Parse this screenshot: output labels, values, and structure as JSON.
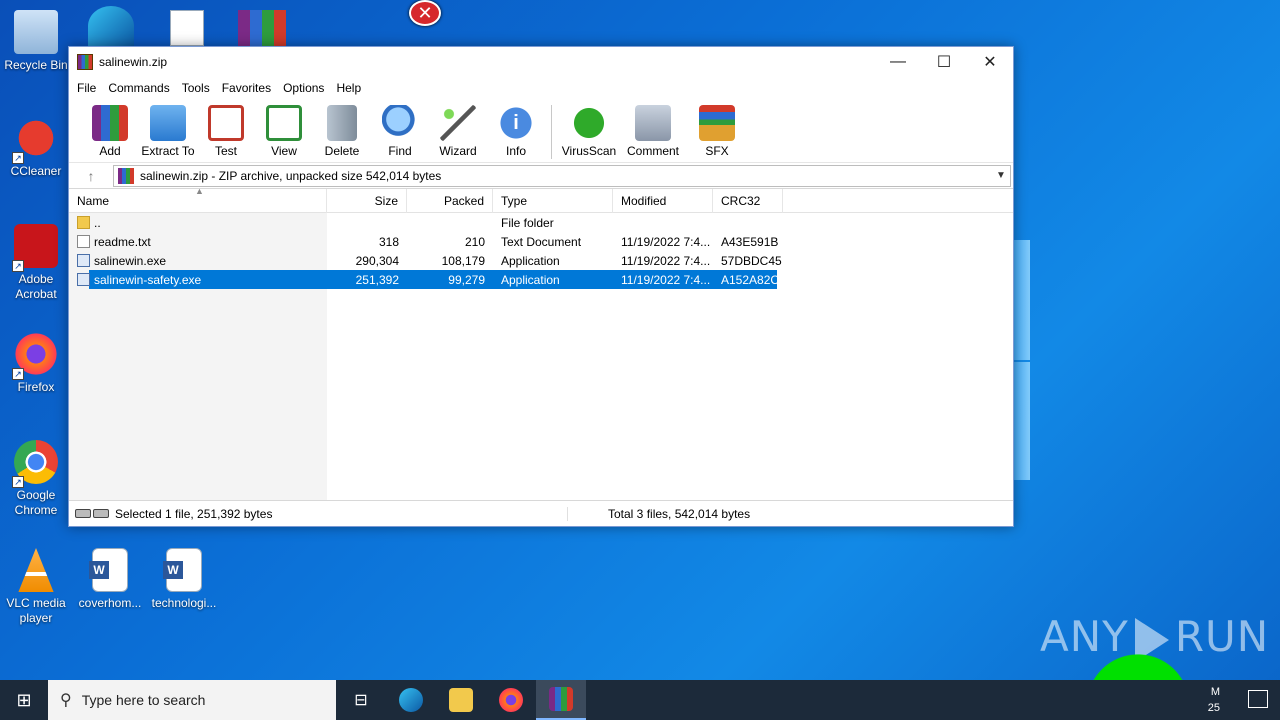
{
  "desktop": {
    "icons": [
      {
        "label": "Recycle Bin"
      },
      {
        "label": "CCleaner"
      },
      {
        "label": "Adobe Acrobat"
      },
      {
        "label": "Firefox"
      },
      {
        "label": "Google Chrome"
      },
      {
        "label": "VLC media player"
      },
      {
        "label": "coverhom..."
      },
      {
        "label": "technologi..."
      }
    ],
    "watermark": {
      "left": "ANY",
      "right": "RUN"
    }
  },
  "window": {
    "title": "salinewin.zip",
    "controls": {
      "minimize": "—",
      "maximize": "☐",
      "close": "✕"
    },
    "menu": [
      "File",
      "Commands",
      "Tools",
      "Favorites",
      "Options",
      "Help"
    ],
    "toolbar": [
      {
        "label": "Add",
        "icon": "add-icon",
        "color": "#b0322c"
      },
      {
        "label": "Extract To",
        "icon": "extract-folder-icon",
        "color": "#3a87d6"
      },
      {
        "label": "Test",
        "icon": "test-clipboard-icon",
        "color": "#c0392b"
      },
      {
        "label": "View",
        "icon": "view-book-icon",
        "color": "#2f8f3a"
      },
      {
        "label": "Delete",
        "icon": "delete-bin-icon",
        "color": "#8a9aaa"
      },
      {
        "label": "Find",
        "icon": "find-magnifier-icon",
        "color": "#2f6fc4"
      },
      {
        "label": "Wizard",
        "icon": "wizard-wand-icon",
        "color": "#6aa84f"
      },
      {
        "label": "Info",
        "icon": "info-icon",
        "color": "#2d66b8"
      },
      {
        "label": "VirusScan",
        "icon": "virusscan-bug-icon",
        "color": "#2faa2a"
      },
      {
        "label": "Comment",
        "icon": "comment-icon",
        "color": "#8a96a8"
      },
      {
        "label": "SFX",
        "icon": "sfx-box-icon",
        "color": "#e0a030"
      }
    ],
    "address": "salinewin.zip - ZIP archive, unpacked size 542,014 bytes",
    "columns": {
      "name": "Name",
      "size": "Size",
      "packed": "Packed",
      "type": "Type",
      "modified": "Modified",
      "crc": "CRC32"
    },
    "files": [
      {
        "name": "..",
        "size": "",
        "packed": "",
        "type": "File folder",
        "modified": "",
        "crc": "",
        "kind": "folder"
      },
      {
        "name": "readme.txt",
        "size": "318",
        "packed": "210",
        "type": "Text Document",
        "modified": "11/19/2022 7:4...",
        "crc": "A43E591B",
        "kind": "txt"
      },
      {
        "name": "salinewin.exe",
        "size": "290,304",
        "packed": "108,179",
        "type": "Application",
        "modified": "11/19/2022 7:4...",
        "crc": "57DBDC45",
        "kind": "exe"
      },
      {
        "name": "salinewin-safety.exe",
        "size": "251,392",
        "packed": "99,279",
        "type": "Application",
        "modified": "11/19/2022 7:4...",
        "crc": "A152A82C",
        "kind": "exe",
        "selected": true
      }
    ],
    "status": {
      "left": "Selected 1 file, 251,392 bytes",
      "right": "Total 3 files, 542,014 bytes"
    }
  },
  "taskbar": {
    "search_placeholder": "Type here to search",
    "clock_line1": "M",
    "clock_line2": "25"
  },
  "colors": {
    "selection": "#0078d7",
    "taskbar": "#1c2a3a"
  }
}
